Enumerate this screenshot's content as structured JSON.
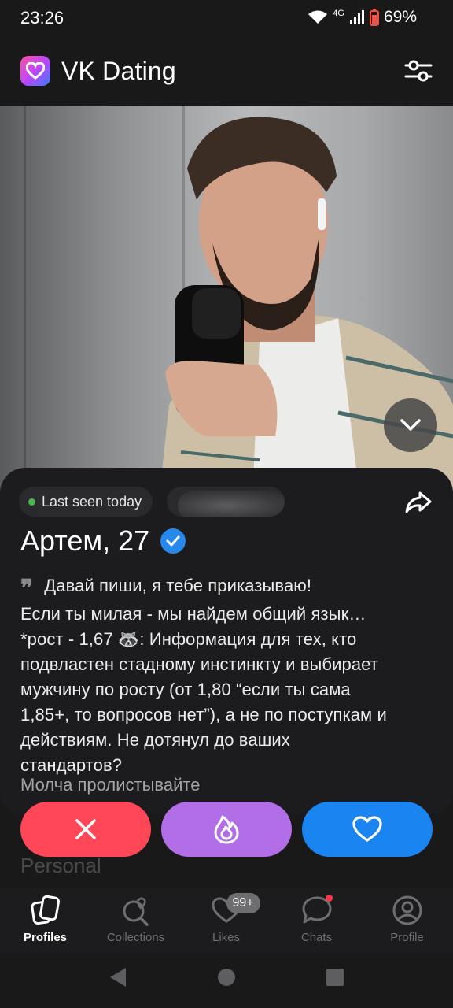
{
  "status": {
    "time": "23:26",
    "network": "4G",
    "battery": "69%"
  },
  "header": {
    "title": "VK Dating"
  },
  "profile": {
    "last_seen": "Last seen today",
    "name_age": "Артем, 27",
    "bio_lines": [
      "Давай пиши, я тебе приказываю!",
      "Если ты милая - мы найдем общий язык…",
      "*рост - 1,67 🦝: Информация для тех, кто",
      "подвластен стадному инстинкту и выбирает",
      "мужчину по росту (от 1,80 “если ты сама",
      "1,85+, то вопросов нет”), а не по поступкам и",
      "действиям. Не дотянул до ваших",
      "стандартов?"
    ],
    "bio_last": "Молча пролистывайте",
    "section": "Personal"
  },
  "tabs": [
    {
      "label": "Profiles",
      "icon": "profiles-icon",
      "active": true
    },
    {
      "label": "Collections",
      "icon": "collections-icon"
    },
    {
      "label": "Likes",
      "icon": "likes-icon",
      "badge": "99+"
    },
    {
      "label": "Chats",
      "icon": "chats-icon"
    },
    {
      "label": "Profile",
      "icon": "profile-icon"
    }
  ],
  "colors": {
    "dislike": "#ff4757",
    "superlike": "#b26ee6",
    "like": "#1a84f1",
    "verified": "#2688eb",
    "online": "#4bb34b"
  }
}
